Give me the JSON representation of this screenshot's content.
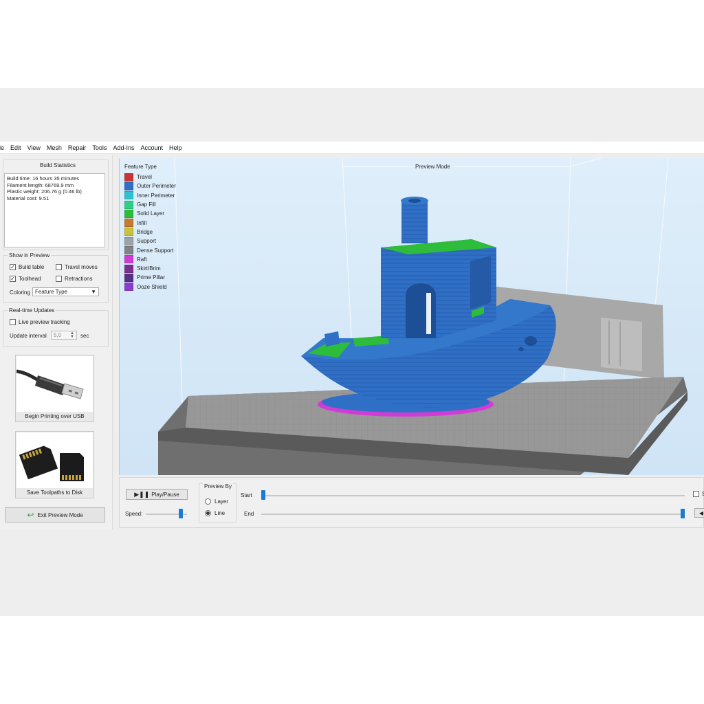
{
  "menubar": [
    "ile",
    "Edit",
    "View",
    "Mesh",
    "Repair",
    "Tools",
    "Add-Ins",
    "Account",
    "Help"
  ],
  "build_statistics": {
    "title": "Build Statistics",
    "lines": [
      "Build time: 16 hours 35 minutes",
      "Filament length: 68769.9 mm",
      "Plastic weight: 206.76 g (0.46 lb)",
      "Material cost: 9.51"
    ]
  },
  "show_in_preview": {
    "title": "Show in Preview",
    "build_table": {
      "label": "Build table",
      "checked": true
    },
    "travel_moves": {
      "label": "Travel moves",
      "checked": false
    },
    "toolhead": {
      "label": "Toolhead",
      "checked": true
    },
    "retractions": {
      "label": "Retractions",
      "checked": false
    },
    "coloring_label": "Coloring",
    "coloring_value": "Feature Type"
  },
  "realtime": {
    "title": "Real-time Updates",
    "live_preview": {
      "label": "Live preview tracking",
      "checked": false
    },
    "interval_label": "Update interval",
    "interval_value": "5,0",
    "interval_unit": "sec"
  },
  "buttons": {
    "usb": "Begin Printing over USB",
    "disk": "Save Toolpaths to Disk",
    "exit": "Exit Preview Mode",
    "play": "Play/Pause"
  },
  "viewport": {
    "mode_label": "Preview Mode",
    "legend_title": "Feature Type",
    "legend": [
      {
        "label": "Travel",
        "color": "#c93434"
      },
      {
        "label": "Outer Perimeter",
        "color": "#2f6fc6"
      },
      {
        "label": "Inner Perimeter",
        "color": "#2ec2cf"
      },
      {
        "label": "Gap Fill",
        "color": "#2fcf86"
      },
      {
        "label": "Solid Layer",
        "color": "#2dbd3a"
      },
      {
        "label": "Infill",
        "color": "#c67a2e"
      },
      {
        "label": "Bridge",
        "color": "#c9c23a"
      },
      {
        "label": "Support",
        "color": "#9da3a6"
      },
      {
        "label": "Dense Support",
        "color": "#808487"
      },
      {
        "label": "Raft",
        "color": "#d23bd6"
      },
      {
        "label": "Skirt/Brim",
        "color": "#7d2f8f"
      },
      {
        "label": "Prime Pillar",
        "color": "#5a2f86"
      },
      {
        "label": "Ooze Shield",
        "color": "#8a3bd0"
      }
    ]
  },
  "controls": {
    "speed_label": "Speed:",
    "speed_level": 0.88,
    "preview_by_title": "Preview By",
    "layer_label": "Layer",
    "line_label": "Line",
    "selected": "Line",
    "start_label": "Start",
    "end_label": "End",
    "start_level": 0.0,
    "end_level": 1.0,
    "cut_label": "S"
  }
}
